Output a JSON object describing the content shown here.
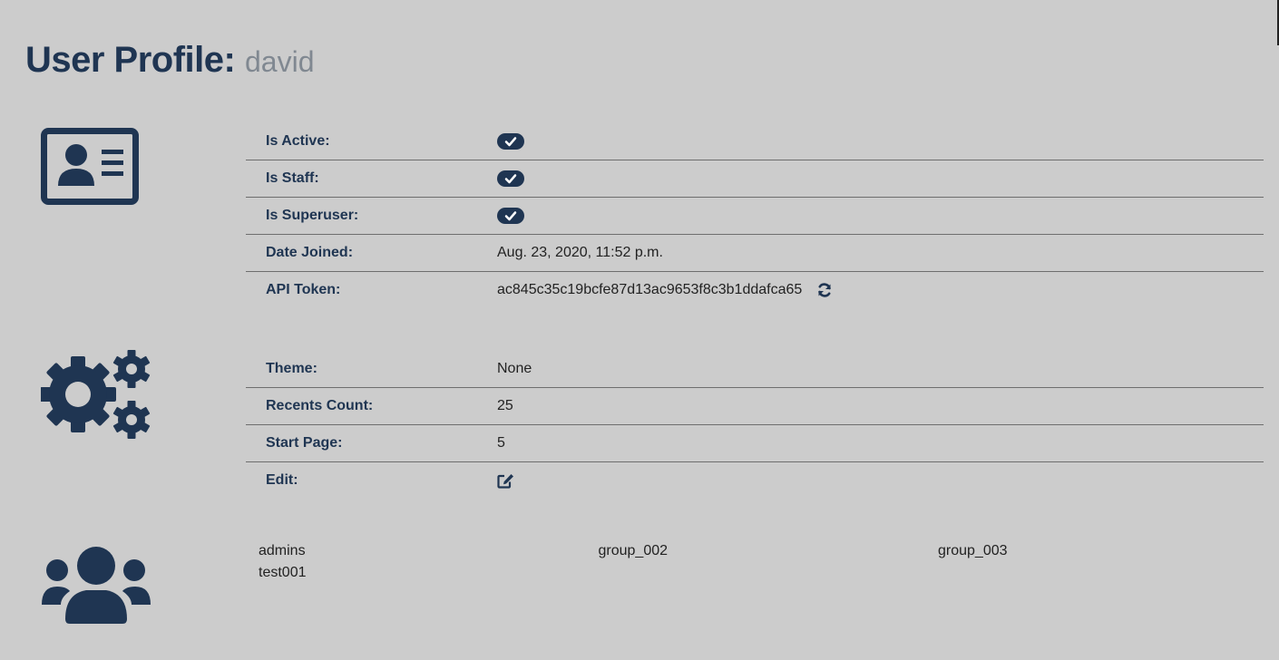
{
  "header": {
    "title": "User Profile:",
    "username": "david"
  },
  "icons": {
    "account": "id-card-icon",
    "preferences": "gears-icon",
    "groups": "users-icon",
    "checkmark": "check-icon",
    "refresh": "refresh-icon",
    "edit": "edit-icon"
  },
  "colors": {
    "primary": "#1f3552",
    "background": "#cccccc",
    "muted": "#808891"
  },
  "account": {
    "is_active": {
      "label": "Is Active:",
      "value": true
    },
    "is_staff": {
      "label": "Is Staff:",
      "value": true
    },
    "is_superuser": {
      "label": "Is Superuser:",
      "value": true
    },
    "date_joined": {
      "label": "Date Joined:",
      "value": "Aug. 23, 2020, 11:52 p.m."
    },
    "api_token": {
      "label": "API Token:",
      "value": "ac845c35c19bcfe87d13ac9653f8c3b1ddafca65"
    }
  },
  "preferences": {
    "theme": {
      "label": "Theme:",
      "value": "None"
    },
    "recents_count": {
      "label": "Recents Count:",
      "value": "25"
    },
    "start_page": {
      "label": "Start Page:",
      "value": "5"
    },
    "edit": {
      "label": "Edit:"
    }
  },
  "groups": [
    "admins",
    "group_002",
    "group_003",
    "test001"
  ]
}
